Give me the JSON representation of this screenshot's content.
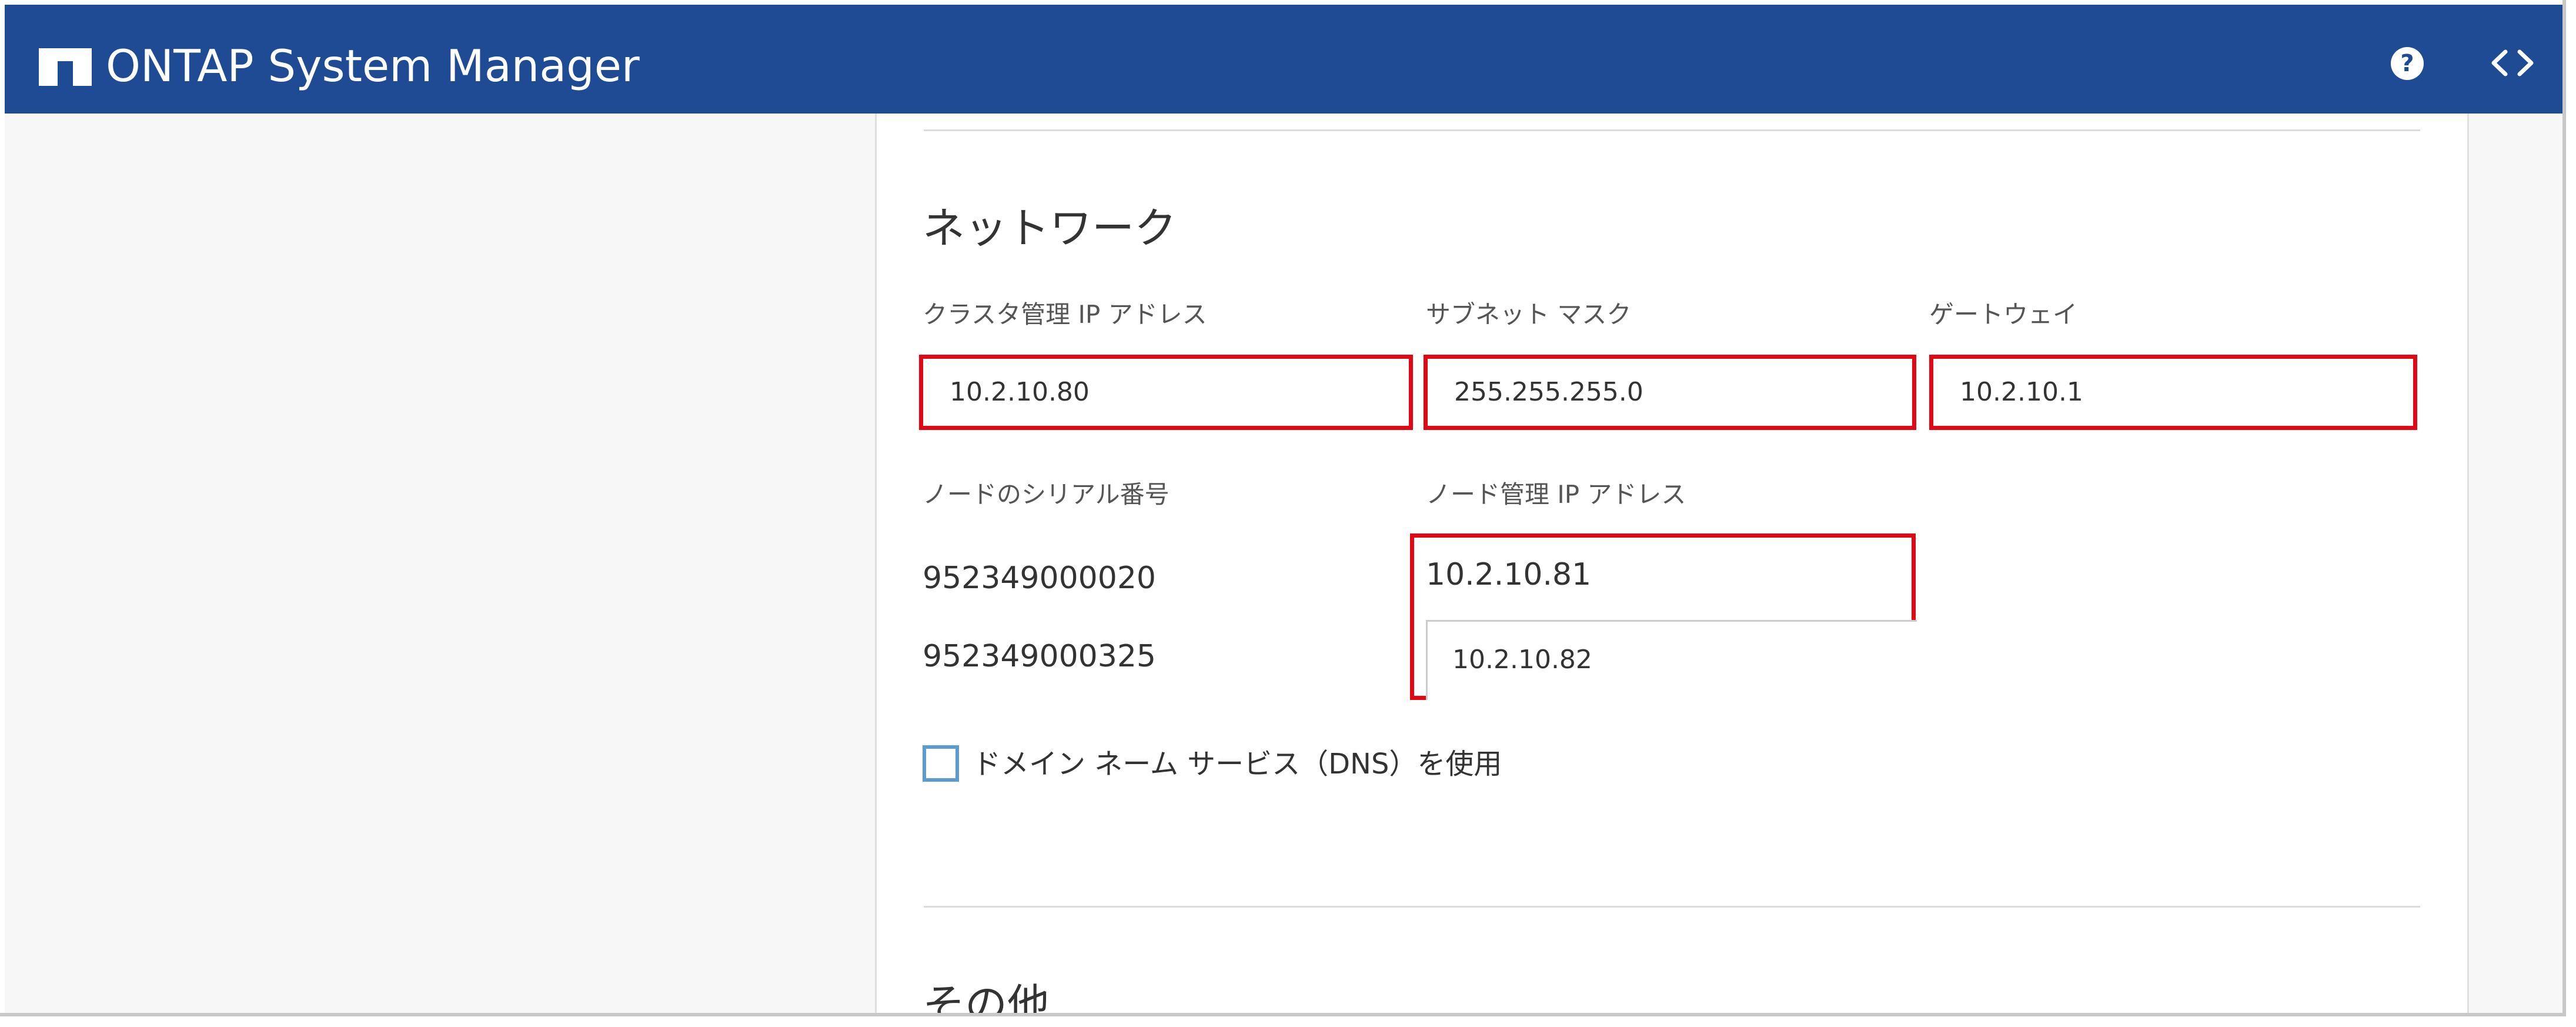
{
  "header": {
    "title": "ONTAP System Manager",
    "help_icon": "?",
    "background": "#1f4b94"
  },
  "network": {
    "section_title": "ネットワーク",
    "cluster_ip": {
      "label": "クラスタ管理 IP アドレス",
      "value": "10.2.10.80"
    },
    "subnet_mask": {
      "label": "サブネット マスク",
      "value": "255.255.255.0"
    },
    "gateway": {
      "label": "ゲートウェイ",
      "value": "10.2.10.1"
    },
    "serial_label": "ノードのシリアル番号",
    "node_ip_label": "ノード管理 IP アドレス",
    "nodes": [
      {
        "serial": "952349000020",
        "ip": "10.2.10.81"
      },
      {
        "serial": "952349000325",
        "ip": "10.2.10.82"
      }
    ],
    "dns_checkbox_label": "ドメイン ネーム サービス（DNS）を使用",
    "dns_checked": false
  },
  "other": {
    "section_title": "その他"
  },
  "colors": {
    "highlight": "#e30613",
    "checkbox_border": "#5b9bd5"
  }
}
